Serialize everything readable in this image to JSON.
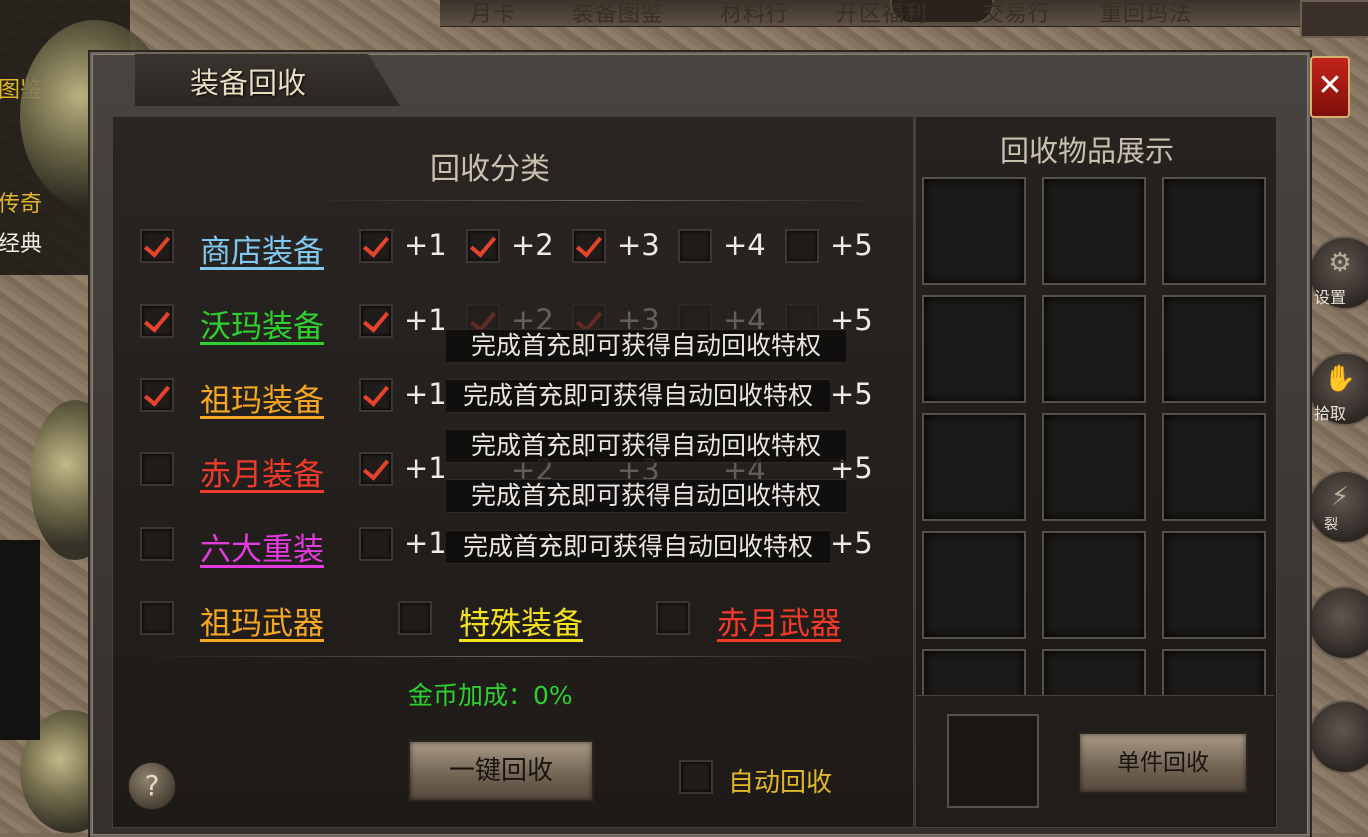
{
  "top_nav": [
    "月卡",
    "装备图鉴",
    "材料行",
    "开区福利",
    "交易行",
    "重回玛法"
  ],
  "left_panel": [
    "图鉴",
    "传奇",
    "经典"
  ],
  "right_buttons": [
    "设置",
    "拾取",
    "裂"
  ],
  "dialog": {
    "title": "装备回收",
    "close_symbol": "✕",
    "category_title": "回收分类",
    "display_title": "回收物品展示",
    "rows": [
      {
        "label": "商店装备",
        "color": "#7fc8ef",
        "checked": true,
        "levels": [
          {
            "label": "+1",
            "checked": true
          },
          {
            "label": "+2",
            "checked": true
          },
          {
            "label": "+3",
            "checked": true
          },
          {
            "label": "+4",
            "checked": false
          },
          {
            "label": "+5",
            "checked": false
          }
        ]
      },
      {
        "label": "沃玛装备",
        "color": "#2ed12e",
        "checked": true,
        "levels": [
          {
            "label": "+1",
            "checked": true
          },
          {
            "label": "+2",
            "checked": true
          },
          {
            "label": "+3",
            "checked": true
          },
          {
            "label": "+4",
            "checked": false
          },
          {
            "label": "+5",
            "checked": false
          }
        ]
      },
      {
        "label": "祖玛装备",
        "color": "#f5a623",
        "checked": true,
        "levels": [
          {
            "label": "+1",
            "checked": true
          },
          {
            "label": "+5",
            "checked": false
          }
        ]
      },
      {
        "label": "赤月装备",
        "color": "#f23a2b",
        "checked": false,
        "levels": [
          {
            "label": "+1",
            "checked": true
          },
          {
            "label": "+2",
            "checked": false
          },
          {
            "label": "+3",
            "checked": false
          },
          {
            "label": "+4",
            "checked": false
          },
          {
            "label": "+5",
            "checked": false
          }
        ]
      },
      {
        "label": "六大重装",
        "color": "#e33be0",
        "checked": false,
        "levels": [
          {
            "label": "+1",
            "checked": false
          },
          {
            "label": "+5",
            "checked": false
          }
        ]
      }
    ],
    "tip": "完成首充即可获得自动回收特权",
    "weapons": [
      {
        "label": "祖玛武器",
        "color": "#f5a623",
        "checked": false
      },
      {
        "label": "特殊装备",
        "color": "#f2e21d",
        "checked": false
      },
      {
        "label": "赤月武器",
        "color": "#f23a2b",
        "checked": false
      }
    ],
    "gold_bonus": "金币加成：0%",
    "one_key_button": "一键回收",
    "auto_recycle_label": "自动回收",
    "auto_recycle_checked": false,
    "single_button": "单件回收",
    "help_symbol": "?"
  }
}
